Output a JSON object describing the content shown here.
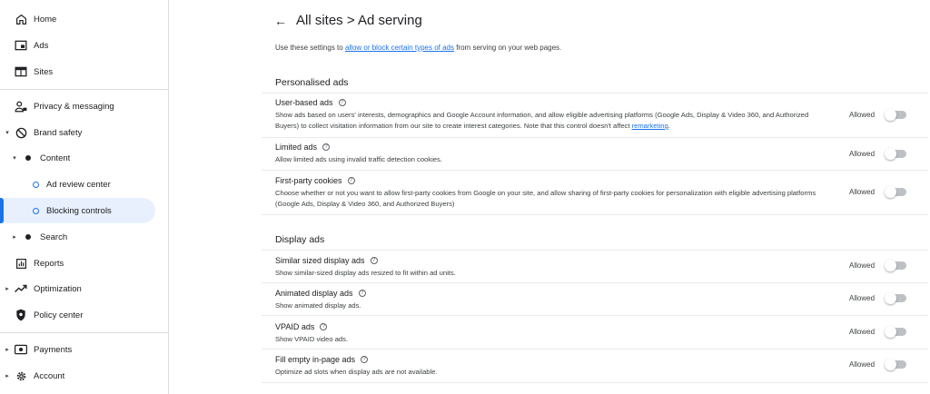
{
  "sidebar": {
    "items": [
      {
        "label": "Home",
        "icon": "home-icon"
      },
      {
        "label": "Ads",
        "icon": "ads-icon"
      },
      {
        "label": "Sites",
        "icon": "sites-icon"
      },
      {
        "label": "Privacy & messaging",
        "icon": "privacy-icon"
      },
      {
        "label": "Brand safety",
        "icon": "block-icon"
      },
      {
        "label": "Content",
        "icon": "dot-icon"
      },
      {
        "label": "Ad review center",
        "icon": "ring-icon"
      },
      {
        "label": "Blocking controls",
        "icon": "ring-icon"
      },
      {
        "label": "Search",
        "icon": "dot-icon"
      },
      {
        "label": "Reports",
        "icon": "reports-icon"
      },
      {
        "label": "Optimization",
        "icon": "trending-icon"
      },
      {
        "label": "Policy center",
        "icon": "shield-icon"
      },
      {
        "label": "Payments",
        "icon": "payments-icon"
      },
      {
        "label": "Account",
        "icon": "gear-icon"
      }
    ]
  },
  "header": {
    "title": "All sites > Ad serving",
    "intro_before": "Use these settings to ",
    "intro_link": "allow or block certain types of ads",
    "intro_after": " from serving on your web pages."
  },
  "sections": [
    {
      "title": "Personalised ads",
      "rows": [
        {
          "title": "User-based ads",
          "desc": "Show ads based on users' interests, demographics and Google Account information, and allow eligible advertising platforms (Google Ads, Display & Video 360, and Authorized Buyers) to collect visitation information from our site to create interest categories. Note that this control doesn't affect ",
          "desc_link": "remarketing",
          "desc_after": ".",
          "status": "Allowed"
        },
        {
          "title": "Limited ads",
          "desc": "Allow limited ads using invalid traffic detection cookies.",
          "status": "Allowed"
        },
        {
          "title": "First-party cookies",
          "desc": "Choose whether or not you want to allow first-party cookies from Google on your site, and allow sharing of first-party cookies for personalization with eligible advertising platforms (Google Ads, Display & Video 360, and Authorized Buyers)",
          "status": "Allowed"
        }
      ]
    },
    {
      "title": "Display ads",
      "rows": [
        {
          "title": "Similar sized display ads",
          "desc": "Show similar-sized display ads resized to fit within ad units.",
          "status": "Allowed"
        },
        {
          "title": "Animated display ads",
          "desc": "Show animated display ads.",
          "status": "Allowed"
        },
        {
          "title": "VPAID ads",
          "desc": "Show VPAID video ads.",
          "status": "Allowed"
        },
        {
          "title": "Fill empty in-page ads",
          "desc": "Optimize ad slots when display ads are not available.",
          "status": "Allowed"
        }
      ]
    }
  ],
  "colors": {
    "accent": "#1a73e8",
    "active_bg": "#e8f0fe",
    "toggle_off": "#bdc1c6"
  }
}
